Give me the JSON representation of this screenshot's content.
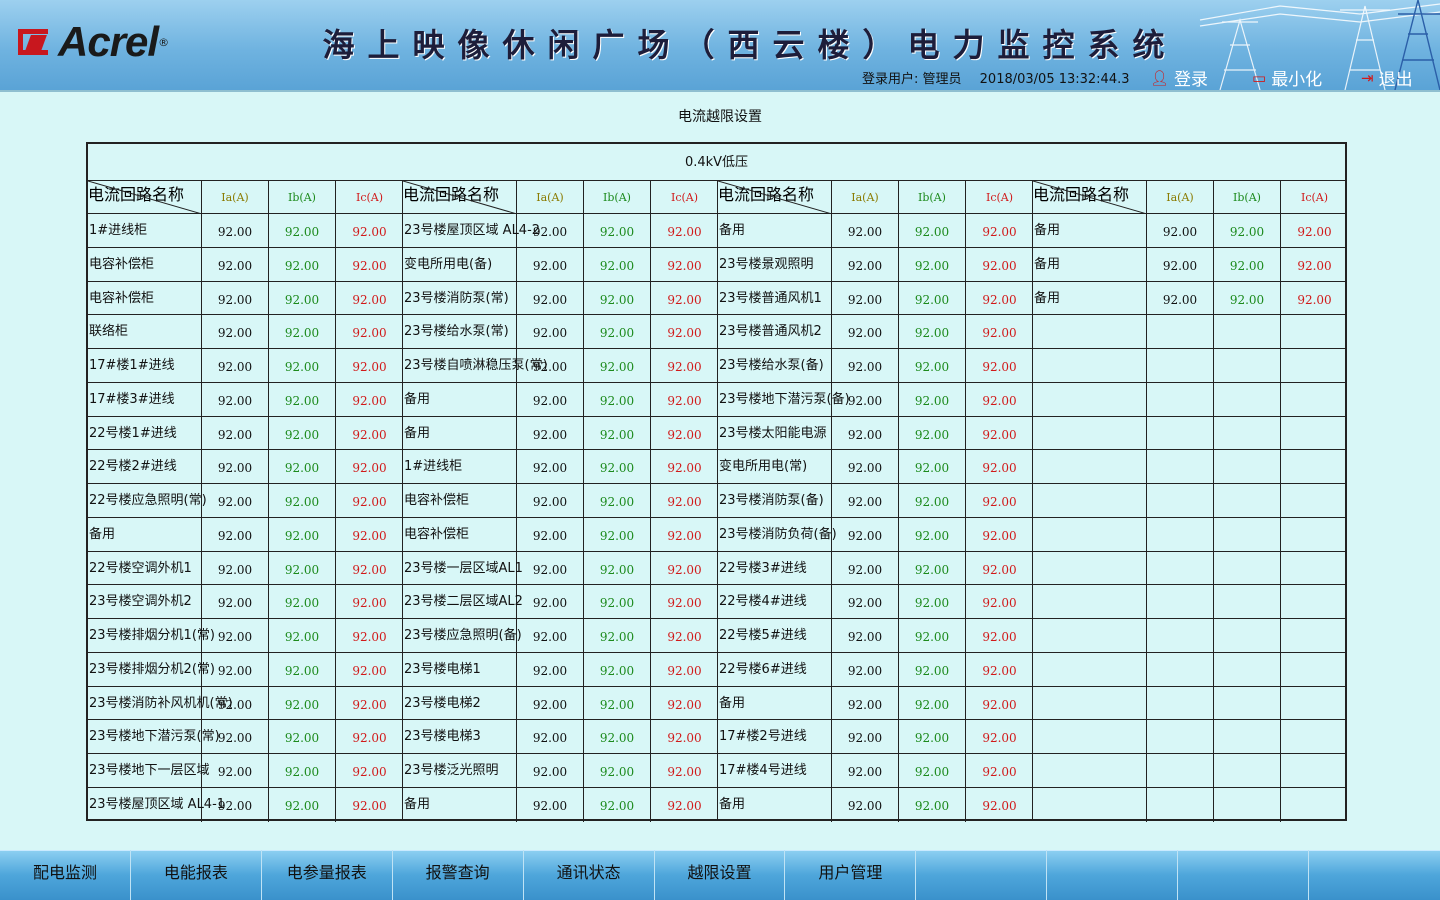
{
  "header": {
    "brand": "Acrel",
    "brand_mark": "®",
    "title": "海上映像休闲广场（西云楼）电力监控系统",
    "user_label": "登录用户: 管理员",
    "datetime": "2018/03/05 13:32:44.3",
    "login": "登录",
    "minimize": "最小化",
    "exit": "退出"
  },
  "page": {
    "title": "电流越限设置",
    "section": "0.4kV低压",
    "diag_top": "电流",
    "diag_bottom": "回路名称",
    "col_ia": "Ia(A)",
    "col_ib": "Ib(A)",
    "col_ic": "Ic(A)"
  },
  "groups": [
    {
      "rows": [
        {
          "name": "1#进线柜",
          "ia": "92.00",
          "ib": "92.00",
          "ic": "92.00"
        },
        {
          "name": "电容补偿柜",
          "ia": "92.00",
          "ib": "92.00",
          "ic": "92.00"
        },
        {
          "name": "电容补偿柜",
          "ia": "92.00",
          "ib": "92.00",
          "ic": "92.00"
        },
        {
          "name": "联络柜",
          "ia": "92.00",
          "ib": "92.00",
          "ic": "92.00"
        },
        {
          "name": "17#楼1#进线",
          "ia": "92.00",
          "ib": "92.00",
          "ic": "92.00"
        },
        {
          "name": "17#楼3#进线",
          "ia": "92.00",
          "ib": "92.00",
          "ic": "92.00"
        },
        {
          "name": "22号楼1#进线",
          "ia": "92.00",
          "ib": "92.00",
          "ic": "92.00"
        },
        {
          "name": "22号楼2#进线",
          "ia": "92.00",
          "ib": "92.00",
          "ic": "92.00"
        },
        {
          "name": "22号楼应急照明(常)",
          "ia": "92.00",
          "ib": "92.00",
          "ic": "92.00"
        },
        {
          "name": "备用",
          "ia": "92.00",
          "ib": "92.00",
          "ic": "92.00"
        },
        {
          "name": "22号楼空调外机1",
          "ia": "92.00",
          "ib": "92.00",
          "ic": "92.00"
        },
        {
          "name": "23号楼空调外机2",
          "ia": "92.00",
          "ib": "92.00",
          "ic": "92.00"
        },
        {
          "name": "23号楼排烟分机1(常)",
          "ia": "92.00",
          "ib": "92.00",
          "ic": "92.00"
        },
        {
          "name": "23号楼排烟分机2(常)",
          "ia": "92.00",
          "ib": "92.00",
          "ic": "92.00"
        },
        {
          "name": "23号楼消防补风机机(常)",
          "ia": "92.00",
          "ib": "92.00",
          "ic": "92.00"
        },
        {
          "name": "23号楼地下潜污泵(常)",
          "ia": "92.00",
          "ib": "92.00",
          "ic": "92.00"
        },
        {
          "name": "23号楼地下一层区域",
          "ia": "92.00",
          "ib": "92.00",
          "ic": "92.00"
        },
        {
          "name": "23号楼屋顶区域 AL4-1",
          "ia": "92.00",
          "ib": "92.00",
          "ic": "92.00"
        }
      ]
    },
    {
      "rows": [
        {
          "name": "23号楼屋顶区域 AL4-2",
          "ia": "92.00",
          "ib": "92.00",
          "ic": "92.00"
        },
        {
          "name": "变电所用电(备)",
          "ia": "92.00",
          "ib": "92.00",
          "ic": "92.00"
        },
        {
          "name": "23号楼消防泵(常)",
          "ia": "92.00",
          "ib": "92.00",
          "ic": "92.00"
        },
        {
          "name": "23号楼给水泵(常)",
          "ia": "92.00",
          "ib": "92.00",
          "ic": "92.00"
        },
        {
          "name": "23号楼自喷淋稳压泵(常)",
          "ia": "92.00",
          "ib": "92.00",
          "ic": "92.00"
        },
        {
          "name": "备用",
          "ia": "92.00",
          "ib": "92.00",
          "ic": "92.00"
        },
        {
          "name": "备用",
          "ia": "92.00",
          "ib": "92.00",
          "ic": "92.00"
        },
        {
          "name": "1#进线柜",
          "ia": "92.00",
          "ib": "92.00",
          "ic": "92.00"
        },
        {
          "name": "电容补偿柜",
          "ia": "92.00",
          "ib": "92.00",
          "ic": "92.00"
        },
        {
          "name": "电容补偿柜",
          "ia": "92.00",
          "ib": "92.00",
          "ic": "92.00"
        },
        {
          "name": "23号楼一层区域AL1",
          "ia": "92.00",
          "ib": "92.00",
          "ic": "92.00"
        },
        {
          "name": "23号楼二层区域AL2",
          "ia": "92.00",
          "ib": "92.00",
          "ic": "92.00"
        },
        {
          "name": "23号楼应急照明(备)",
          "ia": "92.00",
          "ib": "92.00",
          "ic": "92.00"
        },
        {
          "name": "23号楼电梯1",
          "ia": "92.00",
          "ib": "92.00",
          "ic": "92.00"
        },
        {
          "name": "23号楼电梯2",
          "ia": "92.00",
          "ib": "92.00",
          "ic": "92.00"
        },
        {
          "name": "23号楼电梯3",
          "ia": "92.00",
          "ib": "92.00",
          "ic": "92.00"
        },
        {
          "name": "23号楼泛光照明",
          "ia": "92.00",
          "ib": "92.00",
          "ic": "92.00"
        },
        {
          "name": "备用",
          "ia": "92.00",
          "ib": "92.00",
          "ic": "92.00"
        }
      ]
    },
    {
      "rows": [
        {
          "name": "备用",
          "ia": "92.00",
          "ib": "92.00",
          "ic": "92.00"
        },
        {
          "name": "23号楼景观照明",
          "ia": "92.00",
          "ib": "92.00",
          "ic": "92.00"
        },
        {
          "name": "23号楼普通风机1",
          "ia": "92.00",
          "ib": "92.00",
          "ic": "92.00"
        },
        {
          "name": "23号楼普通风机2",
          "ia": "92.00",
          "ib": "92.00",
          "ic": "92.00"
        },
        {
          "name": "23号楼给水泵(备)",
          "ia": "92.00",
          "ib": "92.00",
          "ic": "92.00"
        },
        {
          "name": "23号楼地下潜污泵(备)",
          "ia": "92.00",
          "ib": "92.00",
          "ic": "92.00"
        },
        {
          "name": "23号楼太阳能电源",
          "ia": "92.00",
          "ib": "92.00",
          "ic": "92.00"
        },
        {
          "name": "变电所用电(常)",
          "ia": "92.00",
          "ib": "92.00",
          "ic": "92.00"
        },
        {
          "name": "23号楼消防泵(备)",
          "ia": "92.00",
          "ib": "92.00",
          "ic": "92.00"
        },
        {
          "name": "23号楼消防负荷(备)",
          "ia": "92.00",
          "ib": "92.00",
          "ic": "92.00"
        },
        {
          "name": "22号楼3#进线",
          "ia": "92.00",
          "ib": "92.00",
          "ic": "92.00"
        },
        {
          "name": "22号楼4#进线",
          "ia": "92.00",
          "ib": "92.00",
          "ic": "92.00"
        },
        {
          "name": "22号楼5#进线",
          "ia": "92.00",
          "ib": "92.00",
          "ic": "92.00"
        },
        {
          "name": "22号楼6#进线",
          "ia": "92.00",
          "ib": "92.00",
          "ic": "92.00"
        },
        {
          "name": "备用",
          "ia": "92.00",
          "ib": "92.00",
          "ic": "92.00"
        },
        {
          "name": "17#楼2号进线",
          "ia": "92.00",
          "ib": "92.00",
          "ic": "92.00"
        },
        {
          "name": "17#楼4号进线",
          "ia": "92.00",
          "ib": "92.00",
          "ic": "92.00"
        },
        {
          "name": "备用",
          "ia": "92.00",
          "ib": "92.00",
          "ic": "92.00"
        }
      ]
    },
    {
      "rows": [
        {
          "name": "备用",
          "ia": "92.00",
          "ib": "92.00",
          "ic": "92.00"
        },
        {
          "name": "备用",
          "ia": "92.00",
          "ib": "92.00",
          "ic": "92.00"
        },
        {
          "name": "备用",
          "ia": "92.00",
          "ib": "92.00",
          "ic": "92.00"
        },
        {
          "name": "",
          "ia": "",
          "ib": "",
          "ic": ""
        },
        {
          "name": "",
          "ia": "",
          "ib": "",
          "ic": ""
        },
        {
          "name": "",
          "ia": "",
          "ib": "",
          "ic": ""
        },
        {
          "name": "",
          "ia": "",
          "ib": "",
          "ic": ""
        },
        {
          "name": "",
          "ia": "",
          "ib": "",
          "ic": ""
        },
        {
          "name": "",
          "ia": "",
          "ib": "",
          "ic": ""
        },
        {
          "name": "",
          "ia": "",
          "ib": "",
          "ic": ""
        },
        {
          "name": "",
          "ia": "",
          "ib": "",
          "ic": ""
        },
        {
          "name": "",
          "ia": "",
          "ib": "",
          "ic": ""
        },
        {
          "name": "",
          "ia": "",
          "ib": "",
          "ic": ""
        },
        {
          "name": "",
          "ia": "",
          "ib": "",
          "ic": ""
        },
        {
          "name": "",
          "ia": "",
          "ib": "",
          "ic": ""
        },
        {
          "name": "",
          "ia": "",
          "ib": "",
          "ic": ""
        },
        {
          "name": "",
          "ia": "",
          "ib": "",
          "ic": ""
        },
        {
          "name": "",
          "ia": "",
          "ib": "",
          "ic": ""
        }
      ]
    }
  ],
  "nav": [
    "配电监测",
    "电能报表",
    "电参量报表",
    "报警查询",
    "通讯状态",
    "越限设置",
    "用户管理",
    "",
    "",
    "",
    ""
  ],
  "colors": {
    "ia": "#111111",
    "ib": "#1c8a1c",
    "ic": "#d11a1a",
    "brand_red": "#c8171e"
  }
}
